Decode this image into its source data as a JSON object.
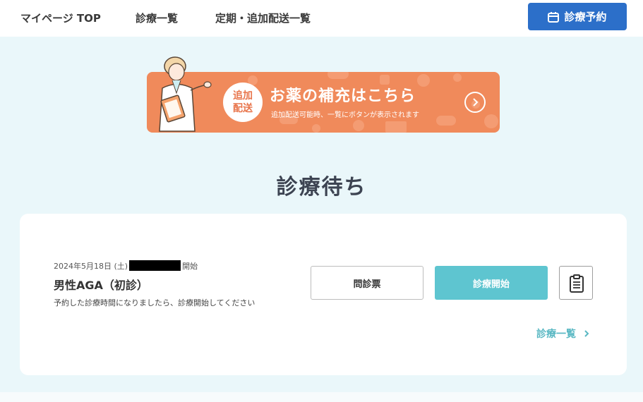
{
  "nav": {
    "items": [
      "マイページ TOP",
      "診療一覧",
      "定期・追加配送一覧"
    ],
    "book_label": "診療予約"
  },
  "banner": {
    "badge_line1": "追加",
    "badge_line2": "配送",
    "title": "お薬の補充はこちら",
    "subtitle": "追加配送可能時、一覧にボタンが表示されます"
  },
  "section": {
    "title": "診療待ち"
  },
  "appointment": {
    "date_prefix": "2024年5月18日 (土)",
    "date_suffix": "開始",
    "name": "男性AGA（初診）",
    "note": "予約した診療時間になりましたら、診療開始してください",
    "questionnaire_label": "問診票",
    "start_label": "診療開始"
  },
  "list_link": {
    "label": "診療一覧"
  },
  "colors": {
    "primary": "#2c6fc9",
    "banner": "#f08a5b",
    "accent": "#5ec5d0",
    "page_bg": "#eaf7fa"
  },
  "icons": [
    "calendar-icon",
    "nurse-illustration",
    "chevron-right-icon",
    "clipboard-icon"
  ]
}
